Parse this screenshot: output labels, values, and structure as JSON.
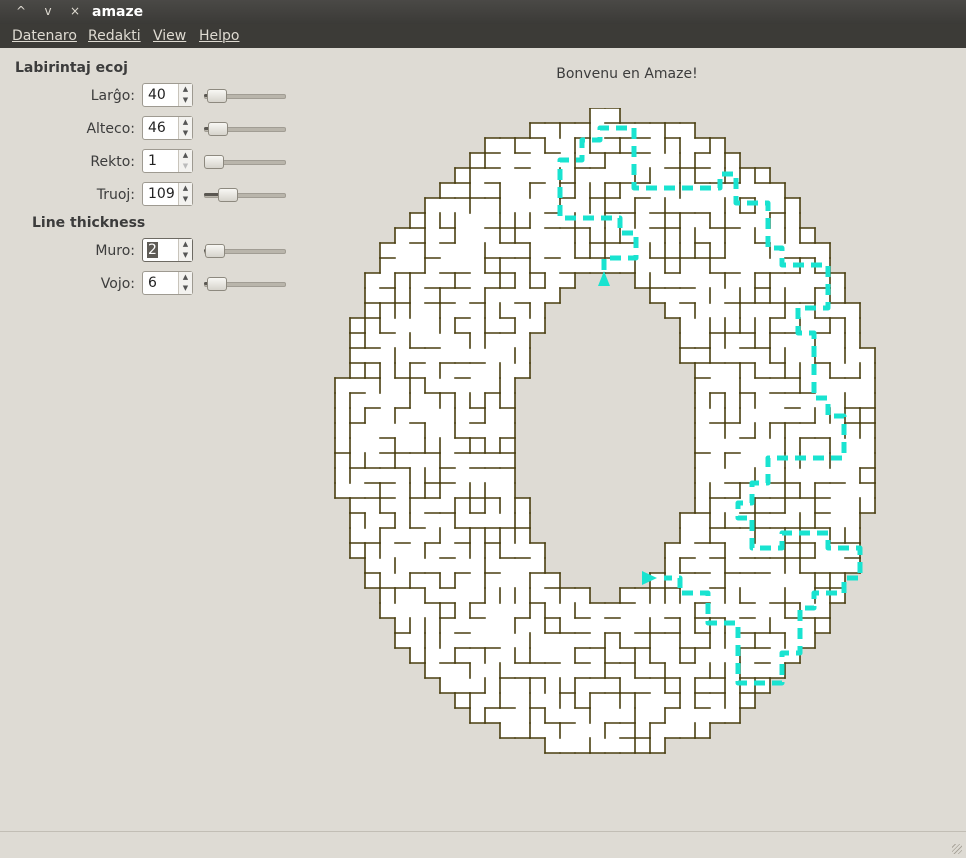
{
  "window": {
    "title": "amaze",
    "controls": [
      "^",
      "v",
      "×"
    ]
  },
  "menu": [
    "Datenaro",
    "Redakti",
    "View",
    "Helpo"
  ],
  "panel": {
    "maze_params_title": "Labirintaj ecoj",
    "line_thickness_title": "Line thickness",
    "rows": [
      {
        "label": "Larĝo:",
        "value": "40",
        "slider": 0.05
      },
      {
        "label": "Alteco:",
        "value": "46",
        "slider": 0.06
      },
      {
        "label": "Rekto:",
        "value": "1",
        "slider": 0.0
      },
      {
        "label": "Truoj:",
        "value": "109",
        "slider": 0.22
      }
    ],
    "thickness_rows": [
      {
        "label": "Muro:",
        "value": "2",
        "slider": 0.02
      },
      {
        "label": "Vojo:",
        "value": "6",
        "slider": 0.04
      }
    ]
  },
  "welcome": "Bonvenu en Amaze!",
  "colors": {
    "maze_wall": "#4a3f10",
    "path": "#19e3d0",
    "marker": "#19e3d0",
    "background": "#dedbd4"
  }
}
